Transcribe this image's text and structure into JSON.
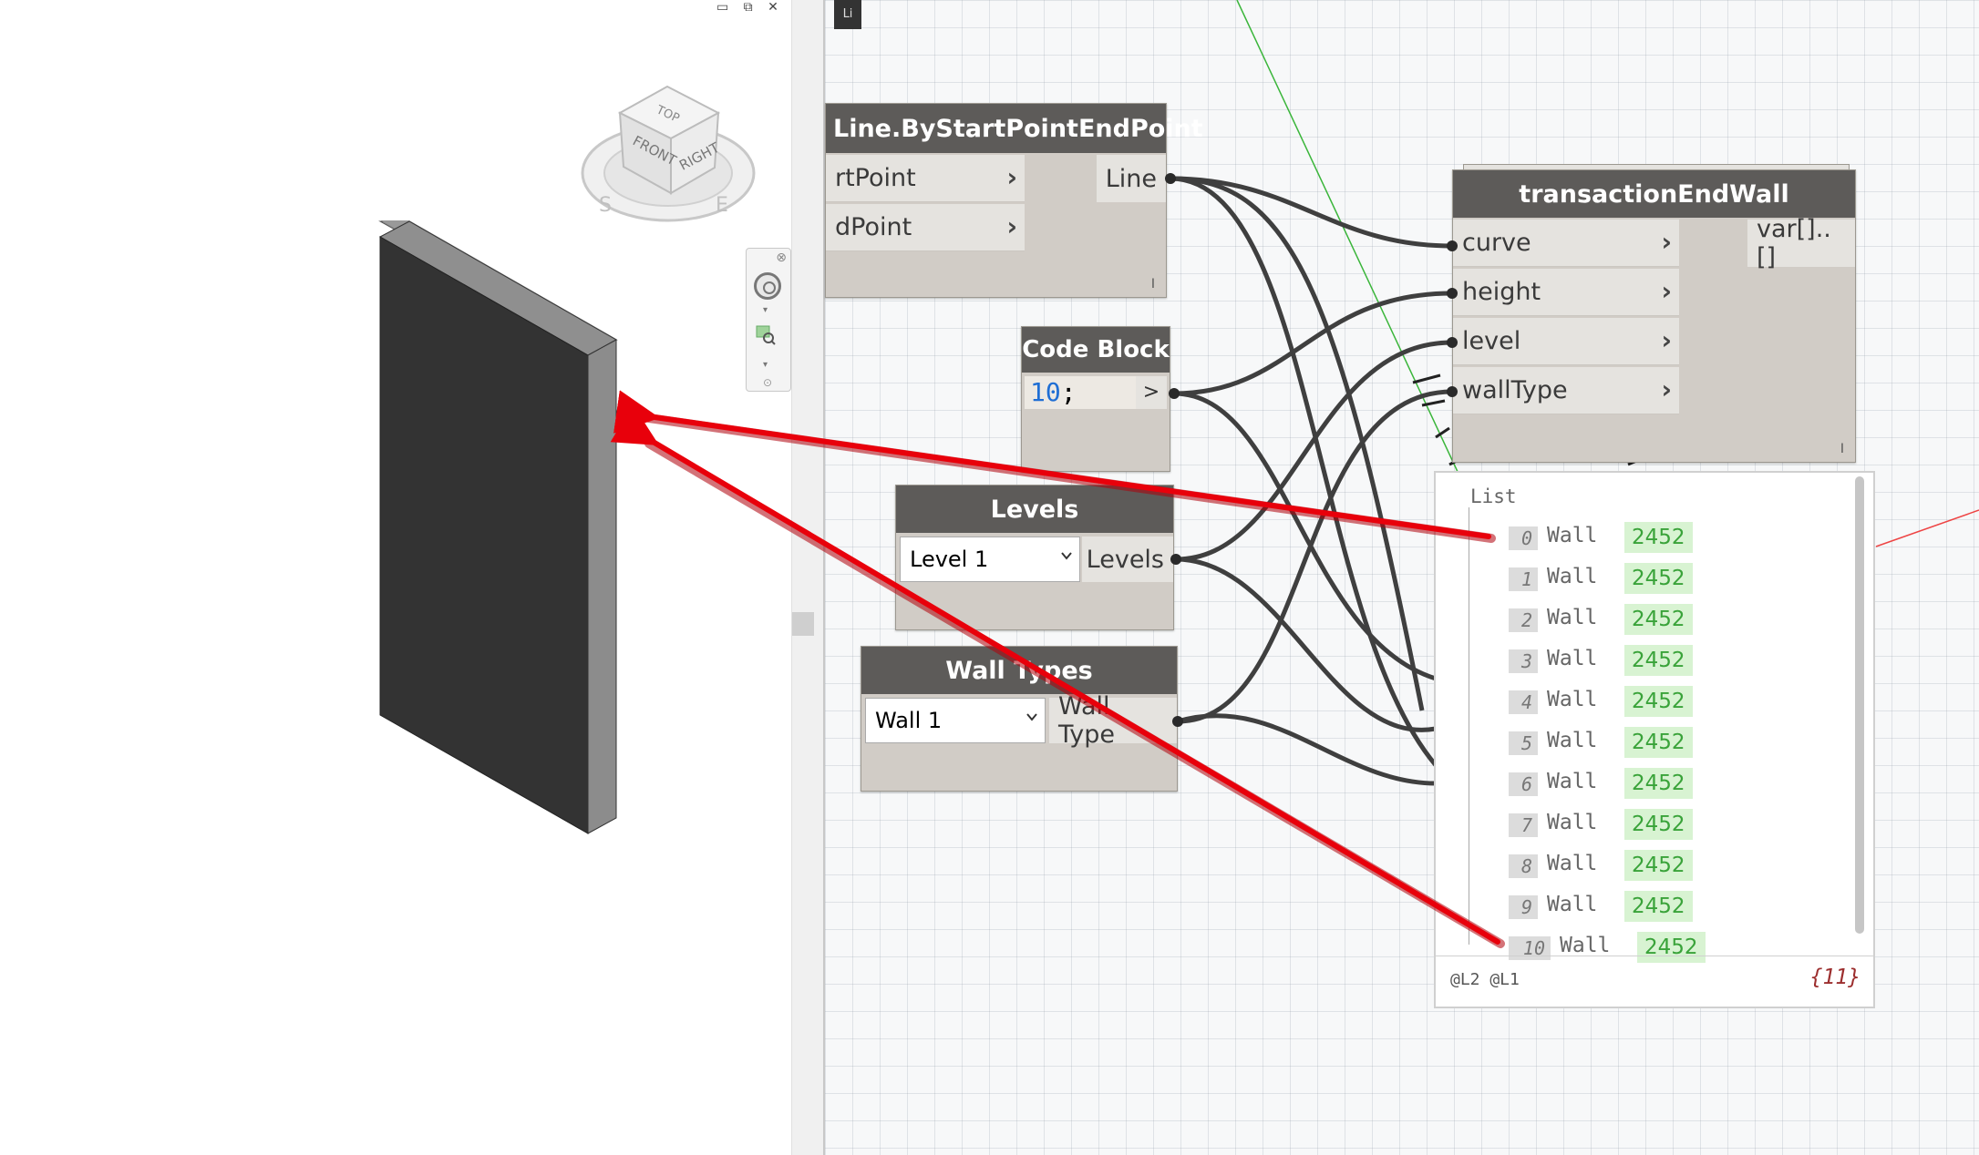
{
  "view3d": {
    "viewcube": {
      "top": "TOP",
      "front": "FRONT",
      "right": "RIGHT",
      "compass_s": "S",
      "compass_e": "E"
    },
    "window_controls": "▭ ⧉ ✕"
  },
  "library_tab": "Li",
  "nodes": {
    "line_node": {
      "title": "Line.ByStartPointEndPoint",
      "inputs": [
        "rtPoint",
        "dPoint"
      ],
      "output": "Line"
    },
    "code_block": {
      "title": "Code Block",
      "code_value": "10",
      "code_semicolon": ";",
      "output": ">"
    },
    "levels": {
      "title": "Levels",
      "selected": "Level 1",
      "output": "Levels"
    },
    "wall_types": {
      "title": "Wall Types",
      "selected": "Wall 1",
      "output": "Wall Type"
    },
    "transaction": {
      "title": "transactionEndWall",
      "inputs": [
        "curve",
        "height",
        "level",
        "wallType"
      ],
      "output": "var[]..[]"
    }
  },
  "watch": {
    "title": "List",
    "items": [
      {
        "index": "0",
        "label": "Wall",
        "value": "2452"
      },
      {
        "index": "1",
        "label": "Wall",
        "value": "2452"
      },
      {
        "index": "2",
        "label": "Wall",
        "value": "2452"
      },
      {
        "index": "3",
        "label": "Wall",
        "value": "2452"
      },
      {
        "index": "4",
        "label": "Wall",
        "value": "2452"
      },
      {
        "index": "5",
        "label": "Wall",
        "value": "2452"
      },
      {
        "index": "6",
        "label": "Wall",
        "value": "2452"
      },
      {
        "index": "7",
        "label": "Wall",
        "value": "2452"
      },
      {
        "index": "8",
        "label": "Wall",
        "value": "2452"
      },
      {
        "index": "9",
        "label": "Wall",
        "value": "2452"
      },
      {
        "index": "10",
        "label": "Wall",
        "value": "2452"
      }
    ],
    "levels": "@L2 @L1",
    "count": "{11}"
  },
  "colors": {
    "annotation_arrow": "#e8000b",
    "node_header": "#5d5b59",
    "wire": "#3f3f3f",
    "wall_face": "#333333",
    "watch_value_bg": "#d8f3d2",
    "watch_value_text": "#3aa33a"
  }
}
